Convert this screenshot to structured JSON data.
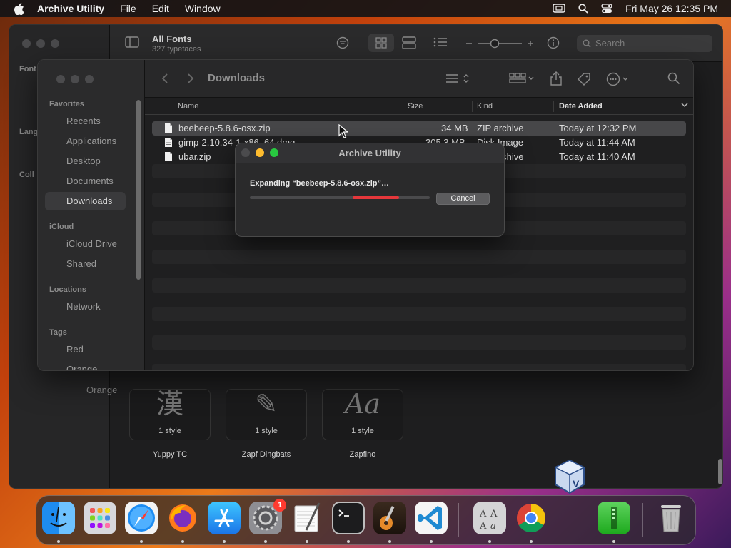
{
  "menubar": {
    "app_name": "Archive Utility",
    "items": [
      "File",
      "Edit",
      "Window"
    ],
    "clock": "Fri May 26  12:35 PM",
    "icons": [
      "screen-mirroring-icon",
      "spotlight-search-icon",
      "control-center-icon"
    ]
  },
  "fontbook": {
    "title": "All Fonts",
    "subtitle": "327 typefaces",
    "search_placeholder": "Search",
    "sidebar_fragments": [
      "Font",
      "Lang",
      "Coll"
    ],
    "sidebar_lower_item": "Orange",
    "tiles": [
      {
        "glyph": "漢",
        "count": "1 style",
        "name": "Yuppy TC"
      },
      {
        "glyph": "✎",
        "count": "1 style",
        "name": "Zapf Dingbats"
      },
      {
        "glyph": "Aa",
        "count": "1 style",
        "name": "Zapfino"
      }
    ]
  },
  "finder": {
    "location": "Downloads",
    "sidebar": {
      "favorites_label": "Favorites",
      "favorites": [
        "Recents",
        "Applications",
        "Desktop",
        "Documents",
        "Downloads"
      ],
      "active_item": "Downloads",
      "icloud_label": "iCloud",
      "icloud": [
        "iCloud Drive",
        "Shared"
      ],
      "locations_label": "Locations",
      "locations": [
        "Network"
      ],
      "tags_label": "Tags",
      "tags": [
        "Red",
        "Orange"
      ]
    },
    "columns": {
      "name": "Name",
      "size": "Size",
      "kind": "Kind",
      "date": "Date Added"
    },
    "files": [
      {
        "name": "beebeep-5.8.6-osx.zip",
        "size": "34 MB",
        "kind": "ZIP archive",
        "date": "Today at 12:32 PM",
        "selected": true
      },
      {
        "name": "gimp-2.10.34-1-x86_64.dmg",
        "size": "305.3 MB",
        "kind": "Disk Image",
        "date": "Today at 11:44 AM",
        "selected": false
      },
      {
        "name": "ubar.zip",
        "size": "",
        "kind": "ZIP archive",
        "date": "Today at 11:40 AM",
        "selected": false
      }
    ]
  },
  "dialog": {
    "title": "Archive Utility",
    "status": "Expanding “beebeep-5.8.6-osx.zip”…",
    "cancel_label": "Cancel",
    "progress_fill_start": 0.57,
    "progress_fill_end": 0.83,
    "colors": {
      "close": "#4b4b4d",
      "minimize": "#febc2e",
      "zoom": "#28c840",
      "progress": "#e5373b"
    }
  },
  "dock": {
    "apps": [
      {
        "name": "Finder",
        "running": true
      },
      {
        "name": "Launchpad",
        "running": false
      },
      {
        "name": "Safari",
        "running": true
      },
      {
        "name": "Firefox",
        "running": true
      },
      {
        "name": "App Store",
        "running": true
      },
      {
        "name": "System Settings",
        "running": true,
        "badge": "1"
      },
      {
        "name": "TextEdit",
        "running": true
      },
      {
        "name": "Terminal",
        "running": true
      },
      {
        "name": "GarageBand",
        "running": true
      },
      {
        "name": "Visual Studio Code",
        "running": true
      },
      {
        "name": "Font Book",
        "running": true
      },
      {
        "name": "Google Chrome",
        "running": true
      },
      {
        "name": "Archive Utility",
        "running": true
      },
      {
        "name": "Trash",
        "running": false
      }
    ]
  }
}
